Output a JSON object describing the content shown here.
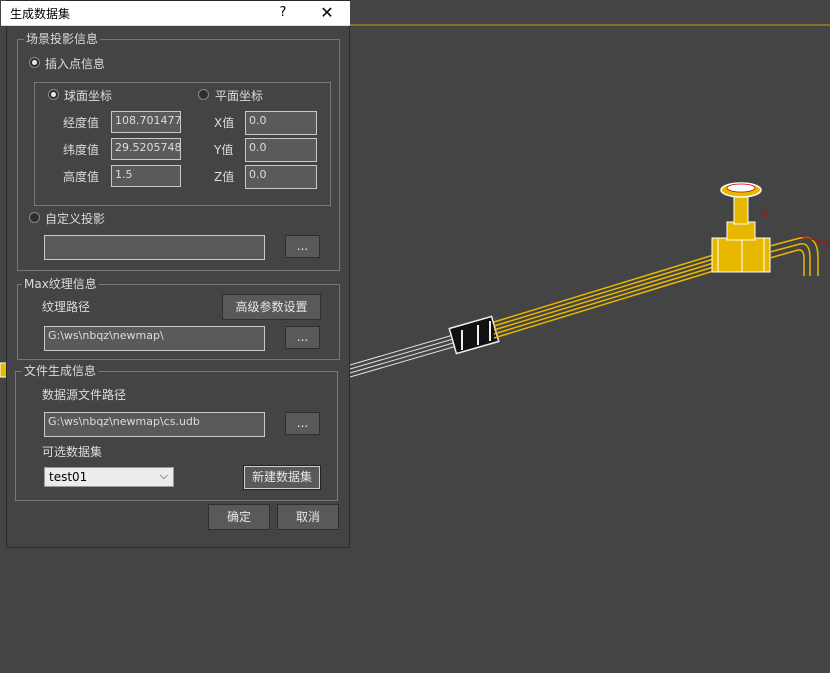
{
  "dialog": {
    "title": "生成数据集",
    "help_icon": "?",
    "close_icon": "✕"
  },
  "projection_group": {
    "title": "场景投影信息",
    "insert_point_radio": "插入点信息",
    "inner": {
      "spherical_radio": "球面坐标",
      "planar_radio": "平面坐标",
      "longitude_label": "经度值",
      "longitude_value": "108.7014770",
      "latitude_label": "纬度值",
      "latitude_value": "29.52057480",
      "height_label": "高度值",
      "height_value": "1.5",
      "x_label": "X值",
      "x_value": "0.0",
      "y_label": "Y值",
      "y_value": "0.0",
      "z_label": "Z值",
      "z_value": "0.0"
    },
    "custom_radio": "自定义投影",
    "custom_value": "",
    "browse_label": "..."
  },
  "texture_group": {
    "title": "Max纹理信息",
    "path_label": "纹理路径",
    "advanced_button": "高级参数设置",
    "path_value": "G:\\ws\\nbqz\\newmap\\",
    "browse_label": "..."
  },
  "file_group": {
    "title": "文件生成信息",
    "source_label": "数据源文件路径",
    "source_value": "G:\\ws\\nbqz\\newmap\\cs.udb",
    "browse_label": "...",
    "dataset_label": "可选数据集",
    "dataset_selected": "test01",
    "new_dataset_button": "新建数据集"
  },
  "footer": {
    "ok_button": "确定",
    "cancel_button": "取消"
  },
  "colors": {
    "background": "#444444",
    "pipe_yellow": "#e8b800",
    "accent_line": "#8a6f2a"
  }
}
